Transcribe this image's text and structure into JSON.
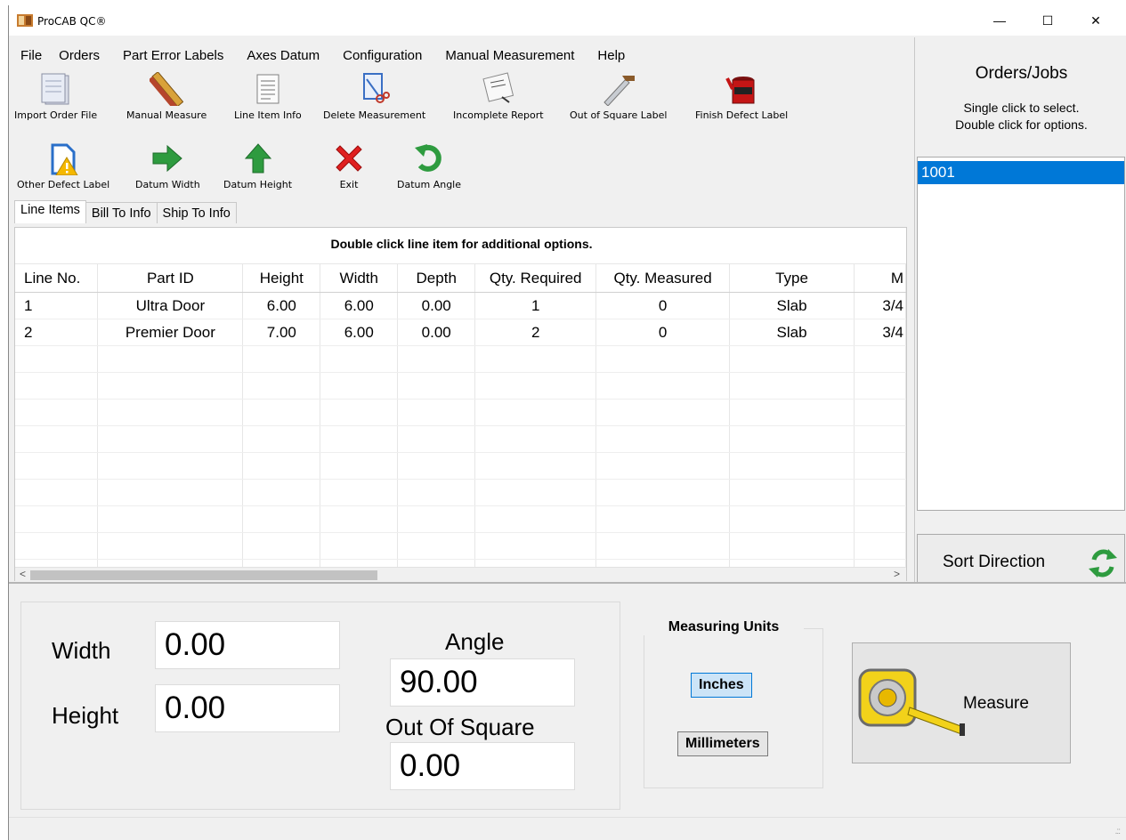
{
  "window": {
    "title": "ProCAB QC®",
    "minimize": "—",
    "maximize": "☐",
    "close": "✕"
  },
  "menu": [
    "File",
    "Orders",
    "Part Error Labels",
    "Axes Datum",
    "Configuration",
    "Manual Measurement",
    "Help"
  ],
  "toolbar_row1": [
    {
      "label": "Import Order File",
      "icon": "import-file-icon"
    },
    {
      "label": "Manual Measure",
      "icon": "tape-ruler-icon"
    },
    {
      "label": "Line Item Info",
      "icon": "document-icon"
    },
    {
      "label": "Delete Measurement",
      "icon": "delete-measurement-icon"
    },
    {
      "label": "Incomplete Report",
      "icon": "incomplete-report-icon"
    },
    {
      "label": "Out of Square Label",
      "icon": "square-tool-icon"
    },
    {
      "label": "Finish Defect Label",
      "icon": "paint-bucket-icon"
    }
  ],
  "toolbar_row2": [
    {
      "label": "Other Defect Label",
      "icon": "warning-file-icon"
    },
    {
      "label": "Datum Width",
      "icon": "arrow-right-icon"
    },
    {
      "label": "Datum Height",
      "icon": "arrow-up-icon"
    },
    {
      "label": "Exit",
      "icon": "red-x-icon"
    },
    {
      "label": "Datum Angle",
      "icon": "rotate-icon"
    }
  ],
  "tabs": [
    "Line Items",
    "Bill To Info",
    "Ship To Info"
  ],
  "hint": "Double click line item for additional options.",
  "grid": {
    "columns": [
      "Line No.",
      "Part ID",
      "Height",
      "Width",
      "Depth",
      "Qty. Required",
      "Qty. Measured",
      "Type",
      "M"
    ],
    "rows": [
      [
        "1",
        "Ultra Door",
        "6.00",
        "6.00",
        "0.00",
        "1",
        "0",
        "Slab",
        "3/4"
      ],
      [
        "2",
        "Premier Door",
        "7.00",
        "6.00",
        "0.00",
        "2",
        "0",
        "Slab",
        "3/4"
      ]
    ]
  },
  "orders": {
    "title": "Orders/Jobs",
    "subtitle_line1": "Single click to select.",
    "subtitle_line2": "Double click for options.",
    "items": [
      "1001"
    ],
    "sort_label": "Sort Direction"
  },
  "measure": {
    "width_label": "Width",
    "width_value": "0.00",
    "height_label": "Height",
    "height_value": "0.00",
    "angle_label": "Angle",
    "angle_value": "90.00",
    "oos_label": "Out Of Square",
    "oos_value": "0.00",
    "units_title": "Measuring Units",
    "unit_inches": "Inches",
    "unit_mm": "Millimeters",
    "selected_unit": "Inches",
    "measure_label": "Measure"
  },
  "scroll": {
    "left_arrow": "<",
    "right_arrow": ">"
  },
  "colors": {
    "selection": "#0078d7",
    "arrow_green": "#2e9b3f",
    "exit_red": "#e02020"
  }
}
